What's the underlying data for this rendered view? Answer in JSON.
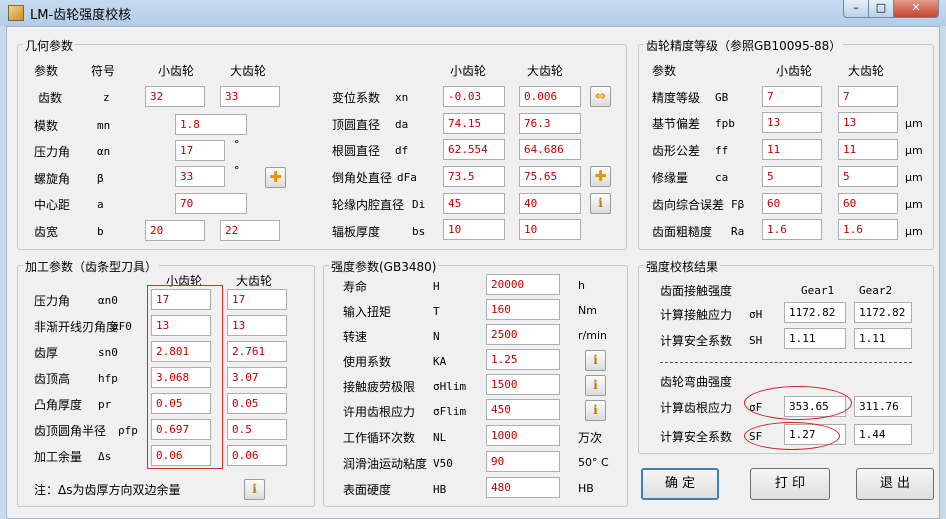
{
  "window": {
    "title": "LM-齿轮强度校核",
    "min": "–",
    "max": "□",
    "close": "✕"
  },
  "geometry": {
    "title": "几何参数",
    "h_param": "参数",
    "h_sym": "符号",
    "h_small": "小齿轮",
    "h_big": "大齿轮",
    "rows": [
      {
        "label": "齿数",
        "sym": "z",
        "small": "32",
        "big": "33"
      },
      {
        "label": "模数",
        "sym": "mn",
        "val": "1.8"
      },
      {
        "label": "压力角",
        "sym": "αn",
        "val": "17",
        "unit": "°"
      },
      {
        "label": "螺旋角",
        "sym": "β",
        "val": "33",
        "unit": "°"
      },
      {
        "label": "中心距",
        "sym": "a",
        "val": "70"
      },
      {
        "label": "齿宽",
        "sym": "b",
        "small": "20",
        "big": "22"
      }
    ],
    "r_small": "小齿轮",
    "r_big": "大齿轮",
    "rrows": [
      {
        "label": "变位系数",
        "sym": "xn",
        "small": "-0.03",
        "big": "0.006"
      },
      {
        "label": "顶圆直径",
        "sym": "da",
        "small": "74.15",
        "big": "76.3"
      },
      {
        "label": "根圆直径",
        "sym": "df",
        "small": "62.554",
        "big": "64.686"
      },
      {
        "label": "倒角处直径",
        "sym": "dFa",
        "small": "73.5",
        "big": "75.65"
      },
      {
        "label": "轮缘内腔直径",
        "sym": "Di",
        "small": "45",
        "big": "40"
      },
      {
        "label": "辐板厚度",
        "sym": "bs",
        "small": "10",
        "big": "10"
      }
    ]
  },
  "precision": {
    "title": "齿轮精度等级（参照GB10095-88）",
    "h_param": "参数",
    "h_small": "小齿轮",
    "h_big": "大齿轮",
    "rows": [
      {
        "label": "精度等级",
        "sym": "GB",
        "small": "7",
        "big": "7",
        "unit": ""
      },
      {
        "label": "基节偏差",
        "sym": "fpb",
        "small": "13",
        "big": "13",
        "unit": "μm"
      },
      {
        "label": "齿形公差",
        "sym": "ff",
        "small": "11",
        "big": "11",
        "unit": "μm"
      },
      {
        "label": "修缘量",
        "sym": "ca",
        "small": "5",
        "big": "5",
        "unit": "μm"
      },
      {
        "label": "齿向综合误差",
        "sym": "Fβ",
        "small": "60",
        "big": "60",
        "unit": "μm"
      },
      {
        "label": "齿面粗糙度",
        "sym": "Ra",
        "small": "1.6",
        "big": "1.6",
        "unit": "μm"
      }
    ]
  },
  "machining": {
    "title": "加工参数（齿条型刀具）",
    "h_small": "小齿轮",
    "h_big": "大齿轮",
    "rows": [
      {
        "label": "压力角",
        "sym": "αn0",
        "small": "17",
        "big": "17"
      },
      {
        "label": "非渐开线刃角度",
        "sym": "αF0",
        "small": "13",
        "big": "13"
      },
      {
        "label": "齿厚",
        "sym": "sn0",
        "small": "2.801",
        "big": "2.761"
      },
      {
        "label": "齿顶高",
        "sym": "hfp",
        "small": "3.068",
        "big": "3.07"
      },
      {
        "label": "凸角厚度",
        "sym": "pr",
        "small": "0.05",
        "big": "0.05"
      },
      {
        "label": "齿顶圆角半径",
        "sym": "ρfp",
        "small": "0.697",
        "big": "0.5"
      },
      {
        "label": "加工余量",
        "sym": "Δs",
        "small": "0.06",
        "big": "0.06"
      }
    ],
    "note": "注：Δs为齿厚方向双边余量"
  },
  "strength": {
    "title": "强度参数(GB3480)",
    "rows": [
      {
        "label": "寿命",
        "sym": "H",
        "val": "20000",
        "unit": "h"
      },
      {
        "label": "输入扭矩",
        "sym": "T",
        "val": "160",
        "unit": "Nm"
      },
      {
        "label": "转速",
        "sym": "N",
        "val": "2500",
        "unit": "r/min"
      },
      {
        "label": "使用系数",
        "sym": "KA",
        "val": "1.25",
        "unit": ""
      },
      {
        "label": "接触疲劳极限",
        "sym": "σHlim",
        "val": "1500",
        "unit": ""
      },
      {
        "label": "许用齿根应力",
        "sym": "σFlim",
        "val": "450",
        "unit": ""
      },
      {
        "label": "工作循环次数",
        "sym": "NL",
        "val": "1000",
        "unit": "万次"
      },
      {
        "label": "润滑油运动粘度",
        "sym": "V50",
        "val": "90",
        "unit": "50° C"
      },
      {
        "label": "表面硬度",
        "sym": "HB",
        "val": "480",
        "unit": "HB"
      }
    ]
  },
  "result": {
    "title": "强度校核结果",
    "contact_title": "齿面接触强度",
    "gear1": "Gear1",
    "gear2": "Gear2",
    "contact_rows": [
      {
        "label": "计算接触应力",
        "sym": "σH",
        "g1": "1172.82",
        "g2": "1172.82"
      },
      {
        "label": "计算安全系数",
        "sym": "SH",
        "g1": "1.11",
        "g2": "1.11"
      }
    ],
    "bending_title": "齿轮弯曲强度",
    "bending_rows": [
      {
        "label": "计算齿根应力",
        "sym": "σF",
        "g1": "353.65",
        "g2": "311.76"
      },
      {
        "label": "计算安全系数",
        "sym": "SF",
        "g1": "1.27",
        "g2": "1.44"
      }
    ]
  },
  "buttons": {
    "ok": "确 定",
    "print": "打 印",
    "exit": "退 出"
  },
  "colors": {
    "value_red": "#c00000",
    "highlight": "#d03030"
  }
}
